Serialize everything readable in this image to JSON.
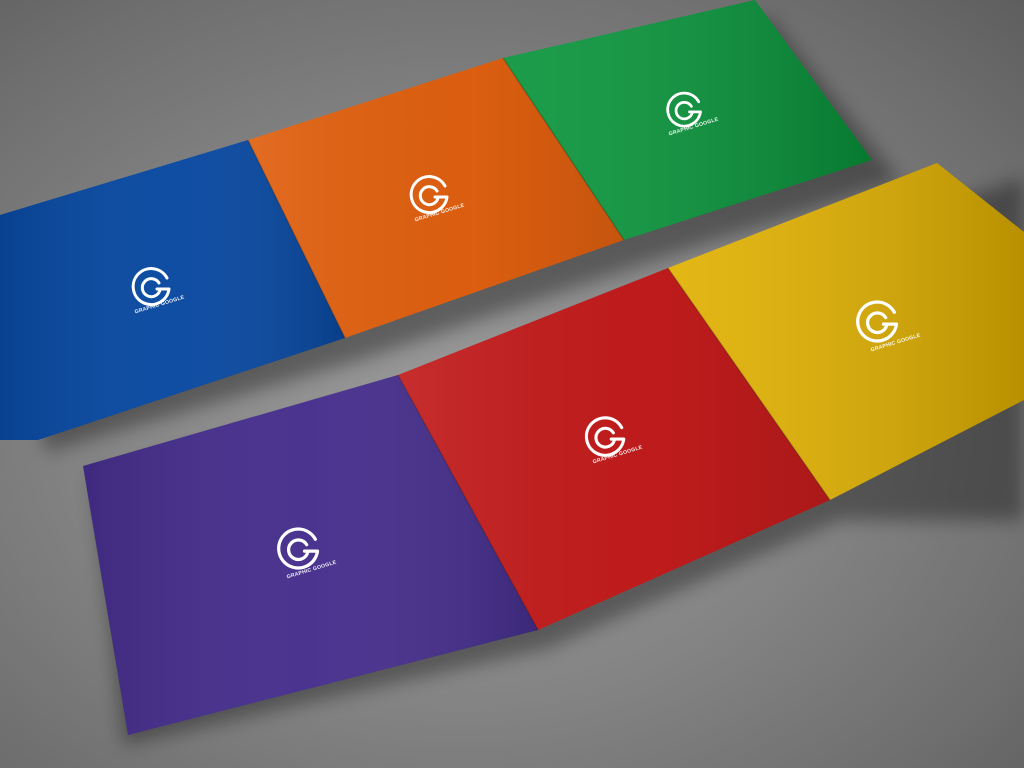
{
  "mockup": {
    "background_color": "#858585",
    "brochures": [
      {
        "name": "top-brochure",
        "panels": [
          {
            "name": "blue-panel",
            "color": "#0848a0",
            "logo_icon": "g-logo-icon",
            "logo_text": "GRAPHIC GOOGLE"
          },
          {
            "name": "orange-panel",
            "color": "#e06010",
            "logo_icon": "g-logo-icon",
            "logo_text": "GRAPHIC GOOGLE"
          },
          {
            "name": "green-panel",
            "color": "#08943a",
            "logo_icon": "g-logo-icon",
            "logo_text": "GRAPHIC GOOGLE"
          }
        ]
      },
      {
        "name": "bottom-brochure",
        "panels": [
          {
            "name": "purple-panel",
            "color": "#452e8c",
            "logo_icon": "g-logo-icon",
            "logo_text": "GRAPHIC GOOGLE"
          },
          {
            "name": "red-panel",
            "color": "#c21c1c",
            "logo_icon": "g-logo-icon",
            "logo_text": "GRAPHIC GOOGLE"
          },
          {
            "name": "yellow-panel",
            "color": "#e0b000",
            "logo_icon": "g-logo-icon",
            "logo_text": "GRAPHIC GOOGLE"
          }
        ]
      }
    ]
  }
}
